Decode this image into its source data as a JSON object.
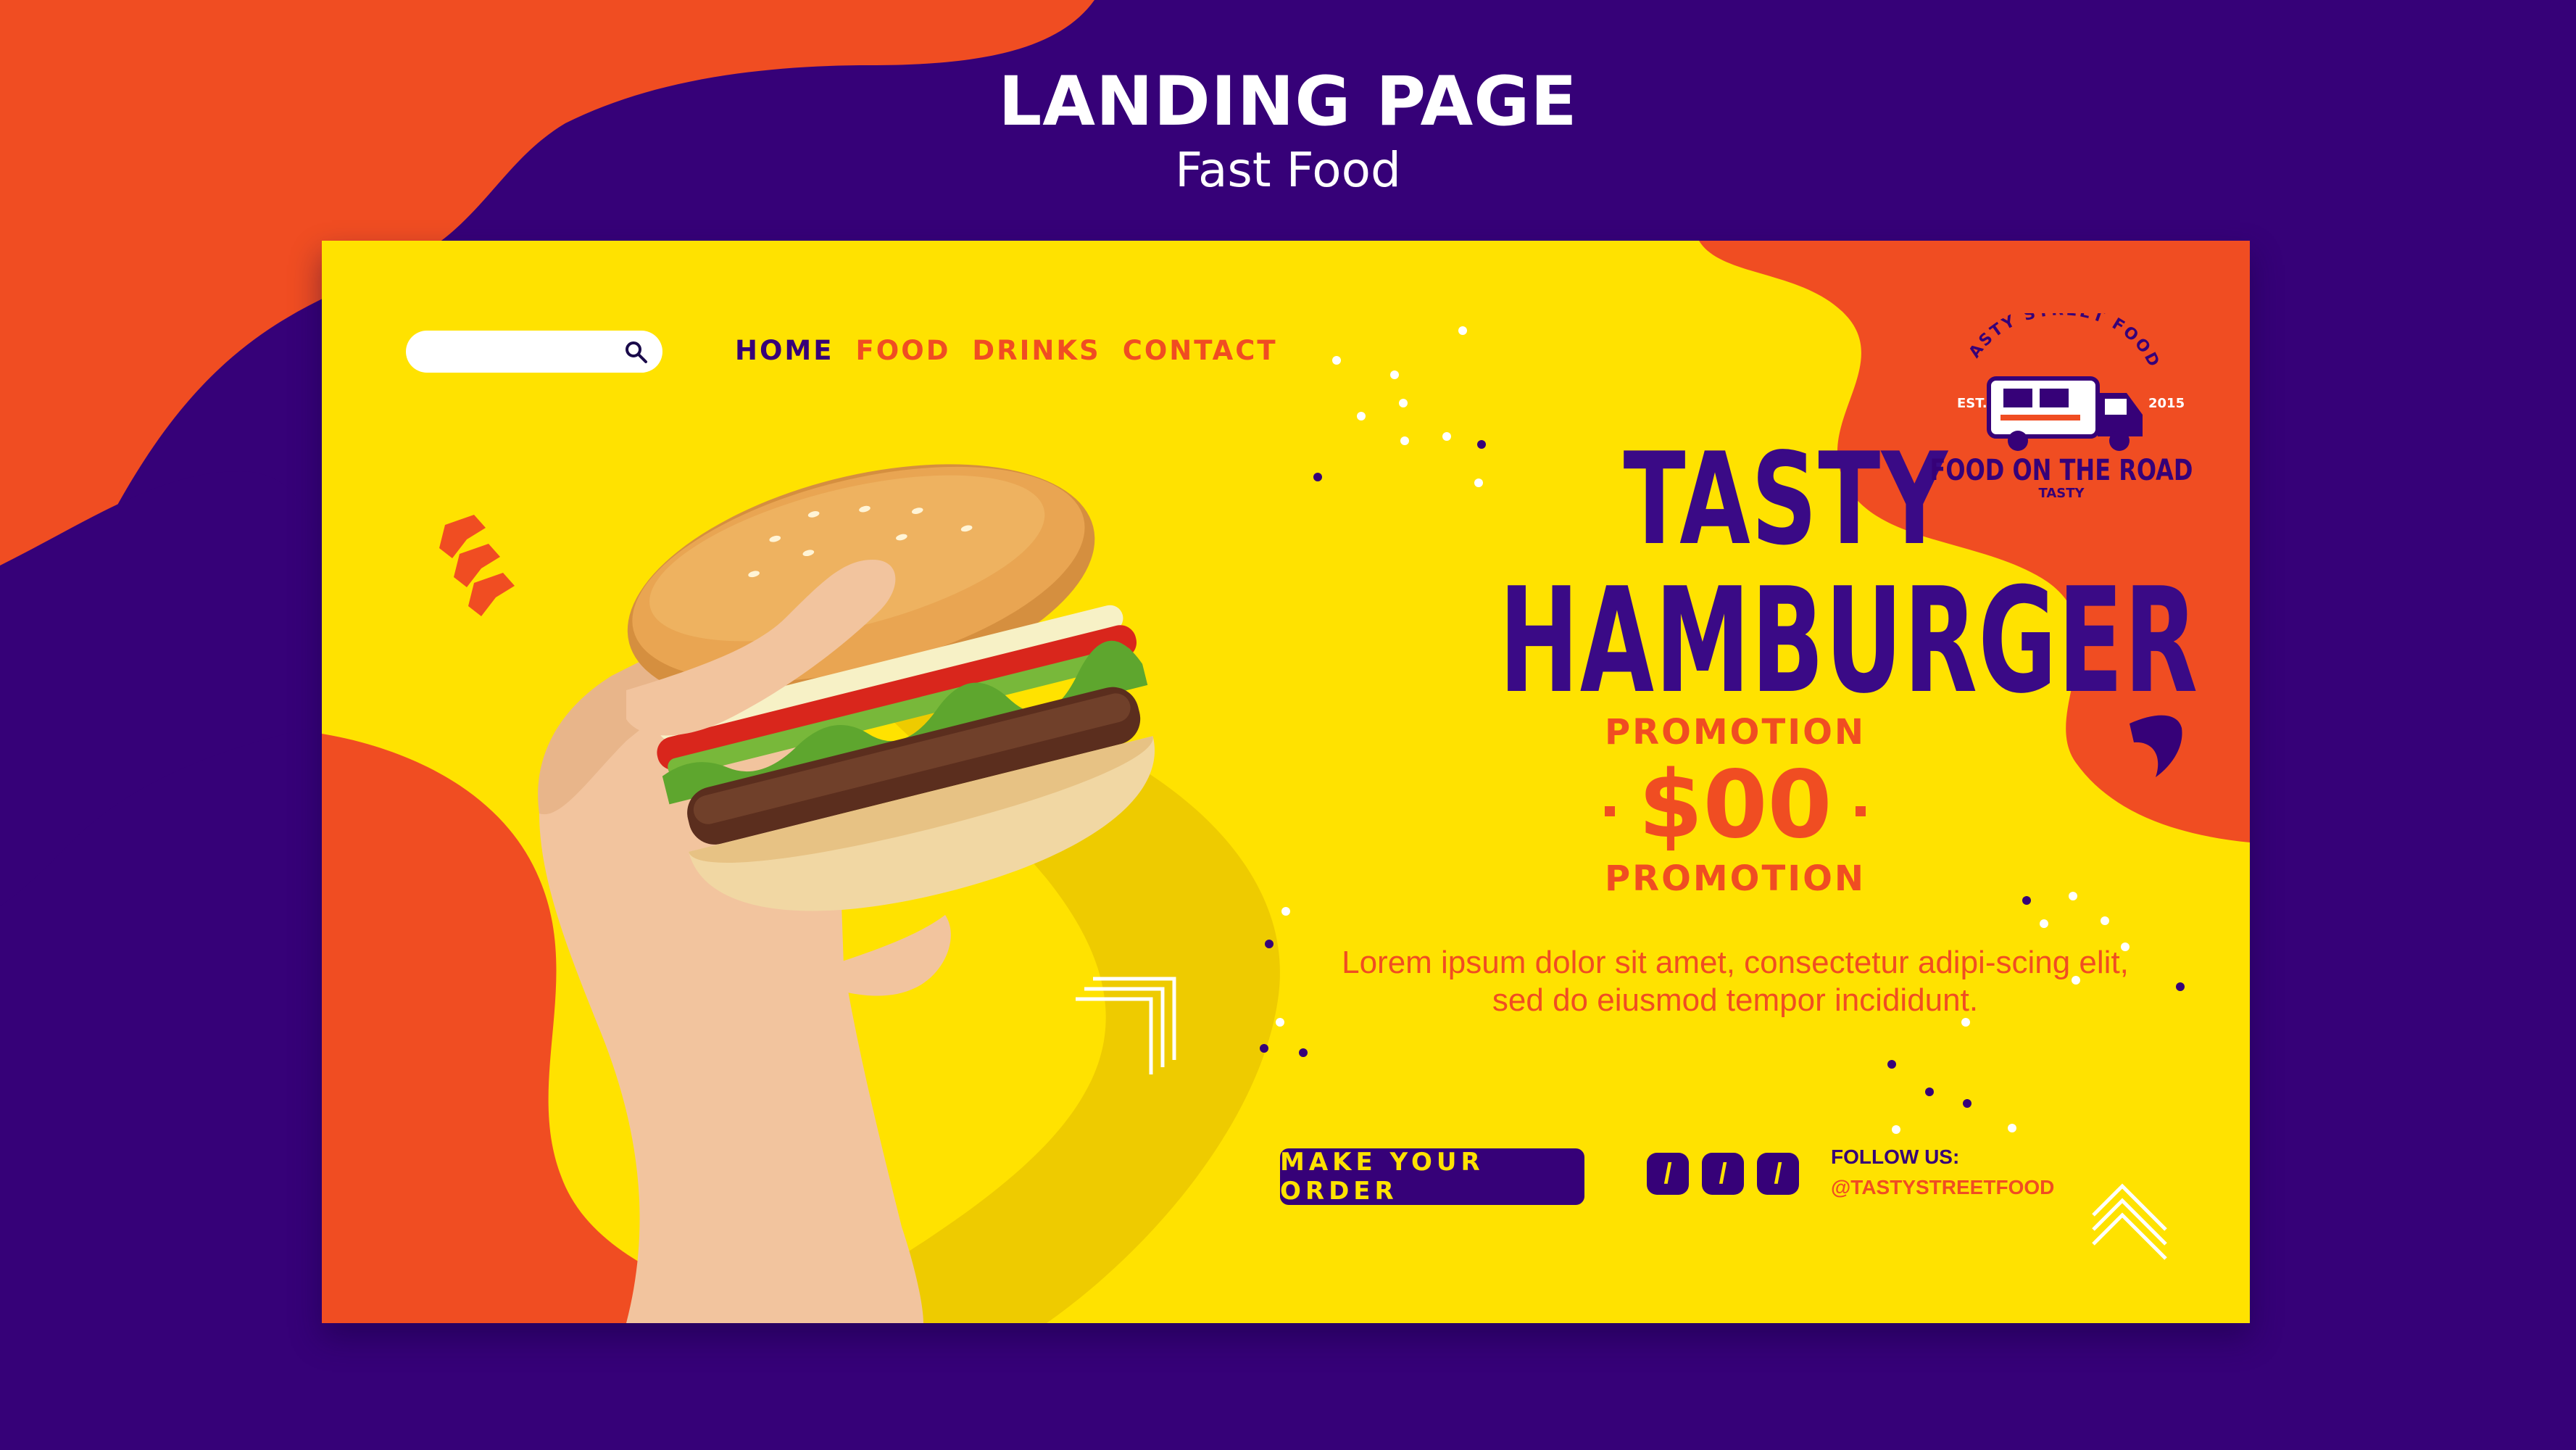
{
  "header": {
    "title": "LANDING PAGE",
    "subtitle": "Fast Food"
  },
  "search": {
    "placeholder": "",
    "value": ""
  },
  "nav": {
    "home": "HOME",
    "food": "FOOD",
    "drinks": "DRINKS",
    "contact": "CONTACT"
  },
  "hero": {
    "title_line1": "TASTY",
    "title_line2": "HAMBURGER",
    "promo_top": "PROMOTION",
    "price": "$00",
    "promo_bottom": "PROMOTION",
    "body_text": "Lorem ipsum dolor sit amet, consectetur adipi-scing elit, sed do eiusmod tempor incididunt."
  },
  "cta": {
    "order_label": "MAKE YOUR ORDER"
  },
  "social": {
    "icons": [
      "/",
      "/",
      "/"
    ],
    "follow_label": "FOLLOW US:",
    "handle": "@TASTYSTREETFOOD"
  },
  "logo": {
    "arc_text": "TASTY STREET FOOD",
    "est": "EST.",
    "year": "2015",
    "name": "FOOD ON THE ROAD",
    "tag": "TASTY"
  },
  "colors": {
    "purple": "#360178",
    "orange": "#f04d22",
    "yellow": "#ffe200",
    "white": "#ffffff"
  },
  "icons": [
    "search-icon",
    "chevron-marks-icon",
    "food-truck-icon",
    "burger-hand-image"
  ]
}
